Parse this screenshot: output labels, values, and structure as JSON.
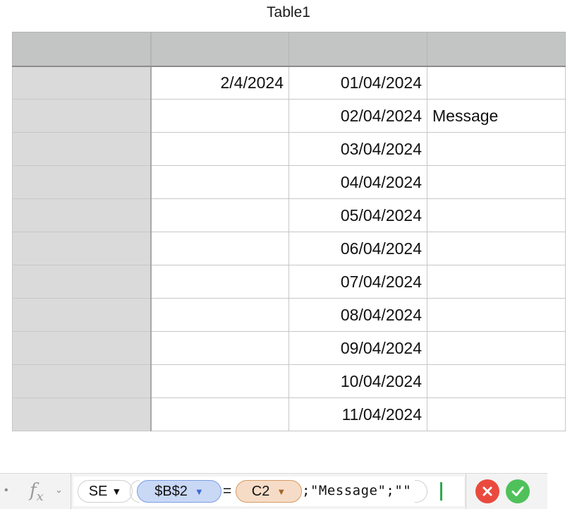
{
  "table": {
    "title": "Table1",
    "columns": [
      "",
      "",
      "",
      ""
    ],
    "rows": [
      {
        "b": "2/4/2024",
        "c": "01/04/2024",
        "d": ""
      },
      {
        "b": "",
        "c": "02/04/2024",
        "d": "Message"
      },
      {
        "b": "",
        "c": "03/04/2024",
        "d": ""
      },
      {
        "b": "",
        "c": "04/04/2024",
        "d": ""
      },
      {
        "b": "",
        "c": "05/04/2024",
        "d": ""
      },
      {
        "b": "",
        "c": "06/04/2024",
        "d": ""
      },
      {
        "b": "",
        "c": "07/04/2024",
        "d": ""
      },
      {
        "b": "",
        "c": "08/04/2024",
        "d": ""
      },
      {
        "b": "",
        "c": "09/04/2024",
        "d": ""
      },
      {
        "b": "",
        "c": "10/04/2024",
        "d": ""
      },
      {
        "b": "",
        "c": "11/04/2024",
        "d": ""
      }
    ]
  },
  "formula_bar": {
    "fx_label": "f",
    "fx_sub": "x",
    "function_name": "SE",
    "ref1": "$B$2",
    "operator": "=",
    "ref2": "C2",
    "rest": ";\"Message\";\"\"",
    "colors": {
      "ref1_fill": "#c9d8f5",
      "ref2_fill": "#f6dcc6",
      "cancel": "#ea4a3d",
      "accept": "#4fc15a"
    },
    "icons": {
      "cancel": "x-circle-icon",
      "accept": "checkmark-circle-icon"
    }
  }
}
